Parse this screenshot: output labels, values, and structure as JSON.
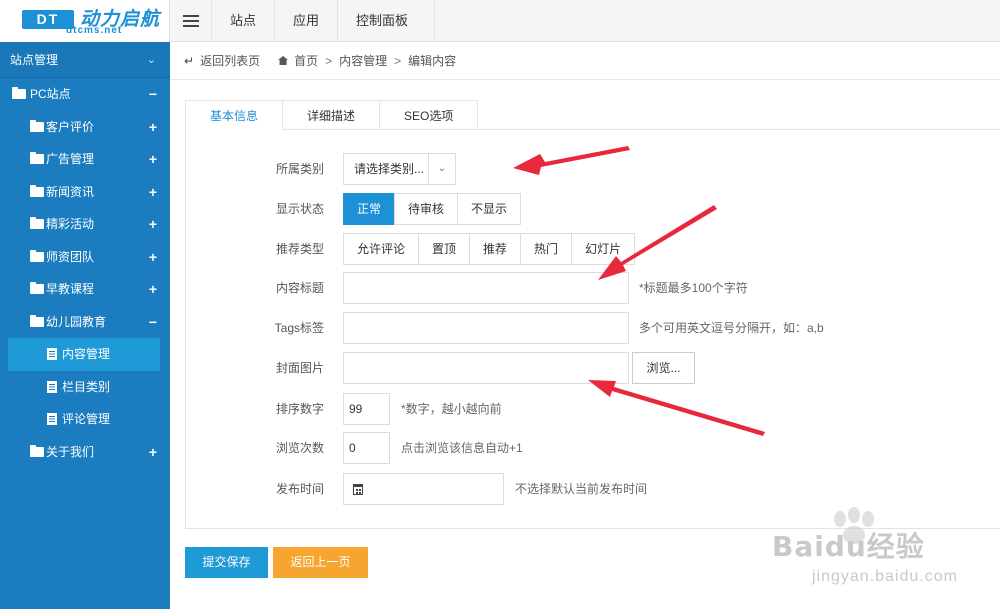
{
  "logo": {
    "badge": "DT",
    "name": "动力启航",
    "sub": "dtcms.net"
  },
  "topnav": {
    "items": [
      "站点",
      "应用",
      "控制面板"
    ]
  },
  "sidebar": {
    "header": "站点管理",
    "items": [
      {
        "label": "PC站点",
        "sign": "−"
      },
      {
        "label": "客户评价",
        "sign": "+"
      },
      {
        "label": "广告管理",
        "sign": "+"
      },
      {
        "label": "新闻资讯",
        "sign": "+"
      },
      {
        "label": "精彩活动",
        "sign": "+"
      },
      {
        "label": "师资团队",
        "sign": "+"
      },
      {
        "label": "早教课程",
        "sign": "+"
      },
      {
        "label": "幼儿园教育",
        "sign": "−"
      },
      {
        "label": "内容管理"
      },
      {
        "label": "栏目类别"
      },
      {
        "label": "评论管理"
      },
      {
        "label": "关于我们",
        "sign": "+"
      }
    ]
  },
  "breadcrumb": {
    "back": "返回列表页",
    "home": "首页",
    "level1": "内容管理",
    "current": "编辑内容",
    "sep": ">"
  },
  "tabs": [
    "基本信息",
    "详细描述",
    "SEO选项"
  ],
  "form": {
    "category": {
      "label": "所属类别",
      "value": "请选择类别..."
    },
    "status": {
      "label": "显示状态",
      "options": [
        "正常",
        "待审核",
        "不显示"
      ],
      "selected": "正常"
    },
    "recommend": {
      "label": "推荐类型",
      "options": [
        "允许评论",
        "置顶",
        "推荐",
        "热门",
        "幻灯片"
      ]
    },
    "title": {
      "label": "内容标题",
      "value": "",
      "hint": "*标题最多100个字符"
    },
    "tags": {
      "label": "Tags标签",
      "value": "",
      "hint": "多个可用英文逗号分隔开，如：a,b"
    },
    "cover": {
      "label": "封面图片",
      "value": "",
      "browse": "浏览..."
    },
    "sort": {
      "label": "排序数字",
      "value": "99",
      "hint": "*数字，越小越向前"
    },
    "views": {
      "label": "浏览次数",
      "value": "0",
      "hint": "点击浏览该信息自动+1"
    },
    "publish": {
      "label": "发布时间",
      "value": "",
      "hint": "不选择默认当前发布时间"
    }
  },
  "actions": {
    "submit": "提交保存",
    "back": "返回上一页"
  },
  "watermark": {
    "text": "Baidu经验",
    "url": "jingyan.baidu.com"
  },
  "colors": {
    "primary": "#1e90d6",
    "sidebar": "#1b7dbf",
    "back_button": "#f7a531",
    "arrow": "#e8283c"
  }
}
